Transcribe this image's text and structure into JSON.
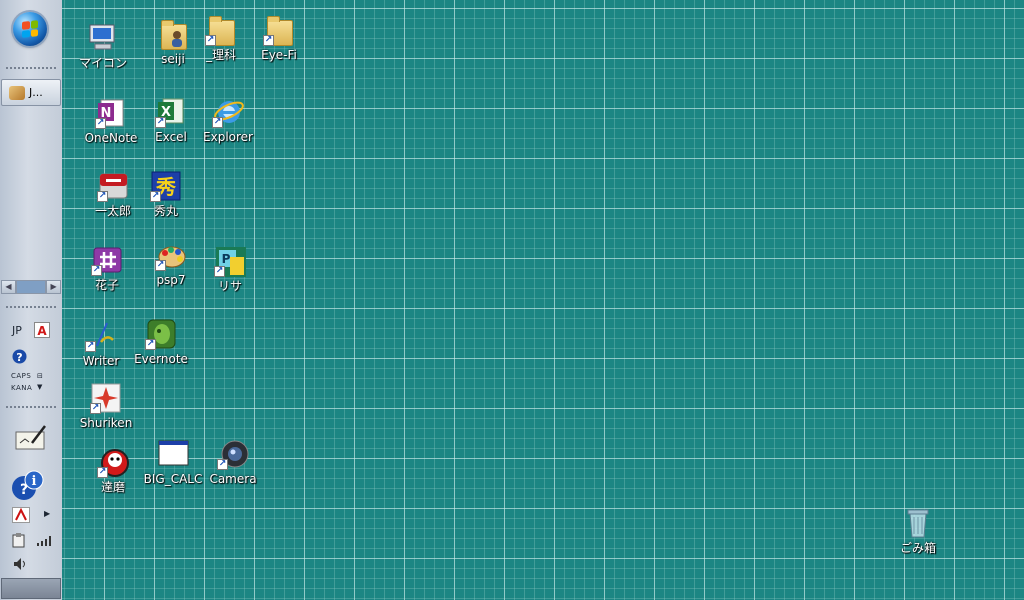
{
  "taskbar": {
    "task_button_label": "J...",
    "lang": "JP",
    "caps": "CAPS",
    "kana": "KANA"
  },
  "desktop_icons": [
    {
      "label": "マイコン",
      "icon": "computer-icon"
    },
    {
      "label": "seiji",
      "icon": "user-folder-icon"
    },
    {
      "label": "_理科",
      "icon": "folder-shortcut-icon"
    },
    {
      "label": "Eye-Fi",
      "icon": "folder-shortcut-icon"
    },
    {
      "label": "OneNote",
      "icon": "onenote-icon"
    },
    {
      "label": "Excel",
      "icon": "excel-icon"
    },
    {
      "label": "Explorer",
      "icon": "internet-explorer-icon"
    },
    {
      "label": "一太郎",
      "icon": "ichitaro-icon"
    },
    {
      "label": "秀丸",
      "icon": "hidemaru-icon"
    },
    {
      "label": "花子",
      "icon": "hanako-icon"
    },
    {
      "label": "psp7",
      "icon": "paintshop-pro-icon"
    },
    {
      "label": "リサ",
      "icon": "lisa-icon"
    },
    {
      "label": "Writer",
      "icon": "writer-icon"
    },
    {
      "label": "Evernote",
      "icon": "evernote-icon"
    },
    {
      "label": "Shuriken",
      "icon": "shuriken-icon"
    },
    {
      "label": "達磨",
      "icon": "daruma-icon"
    },
    {
      "label": "BIG_CALC",
      "icon": "window-app-icon"
    },
    {
      "label": "Camera",
      "icon": "camera-icon"
    },
    {
      "label": "ごみ箱",
      "icon": "recycle-bin-icon"
    }
  ]
}
